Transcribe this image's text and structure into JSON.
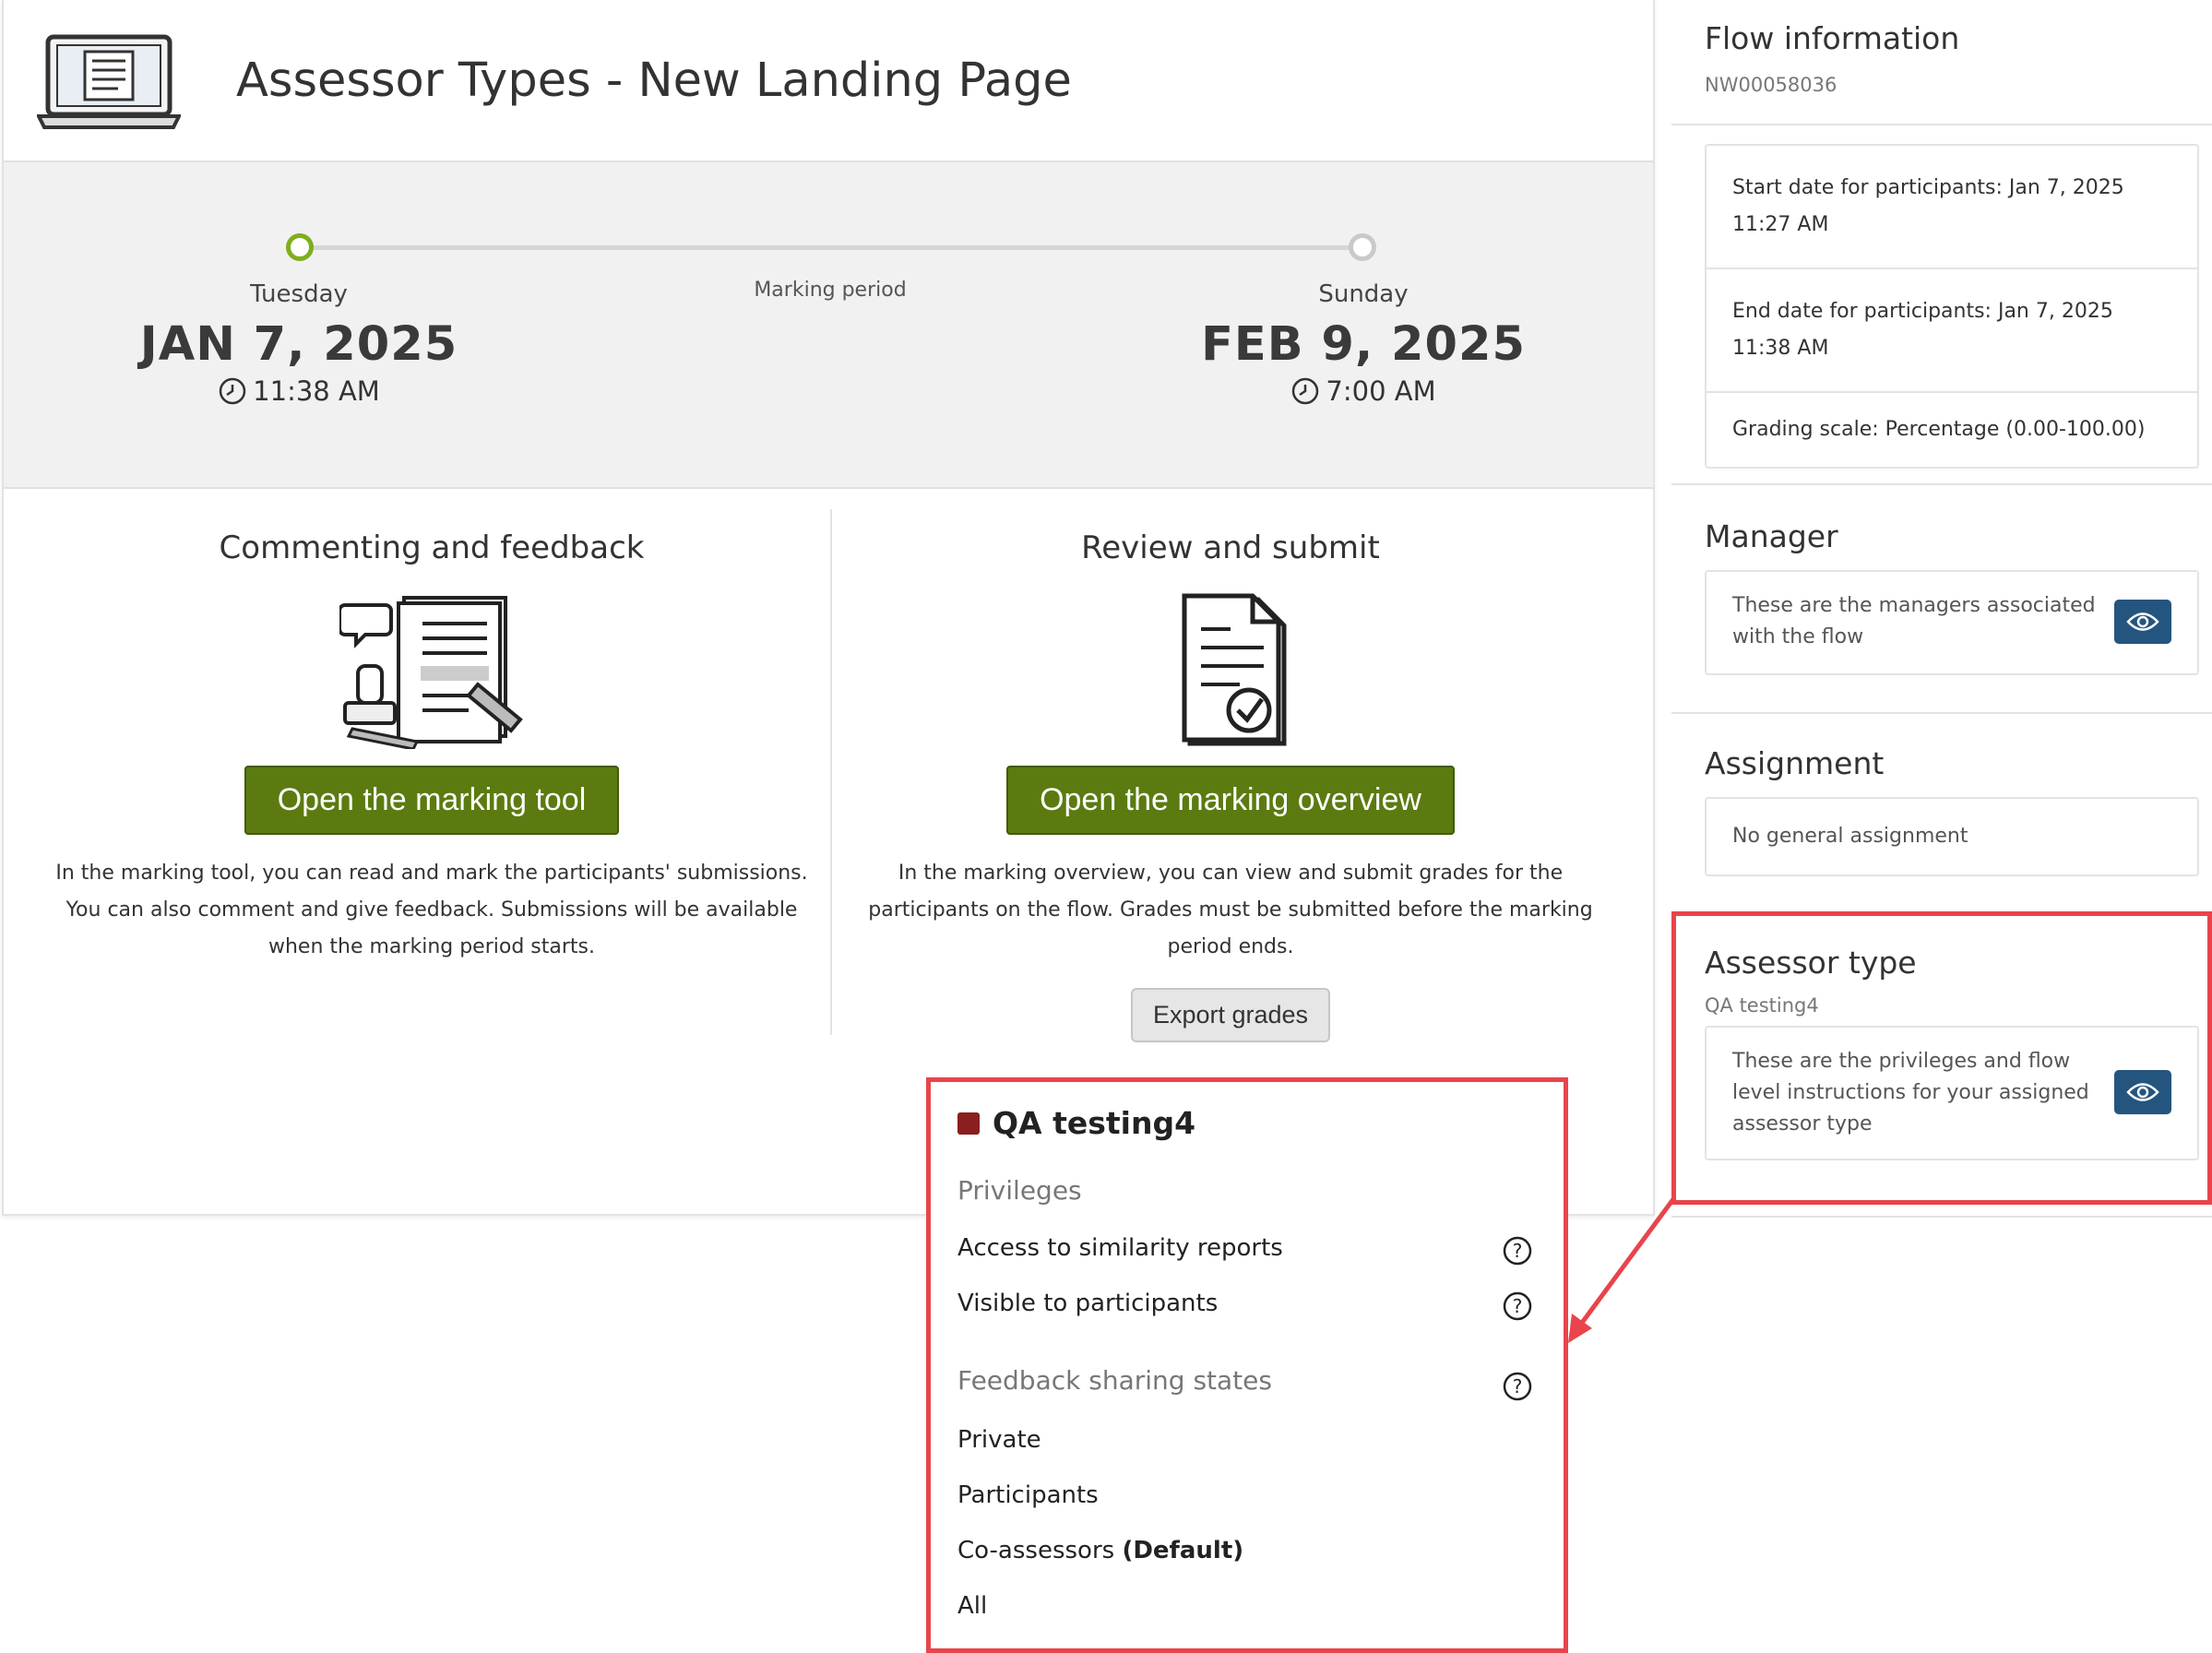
{
  "header": {
    "title": "Assessor Types - New Landing Page"
  },
  "period": {
    "label": "Marking period",
    "start": {
      "weekday": "Tuesday",
      "date": "JAN 7, 2025",
      "time": "11:38 AM"
    },
    "end": {
      "weekday": "Sunday",
      "date": "FEB 9, 2025",
      "time": "7:00 AM"
    }
  },
  "commenting": {
    "heading": "Commenting and feedback",
    "button": "Open the marking tool",
    "text": "In the marking tool, you can read and mark the participants' submissions. You can also comment and give feedback. Submissions will be available when the marking period starts."
  },
  "review": {
    "heading": "Review and submit",
    "button": "Open the marking overview",
    "text": "In the marking overview, you can view and submit grades for the participants on the flow. Grades must be submitted before the marking period ends.",
    "export_button": "Export grades"
  },
  "sidebar": {
    "flow_info": {
      "title": "Flow information",
      "id": "NW00058036",
      "rows": [
        "Start date for participants: Jan 7, 2025 11:27 AM",
        "End date for participants: Jan 7, 2025 11:38 AM",
        "Grading scale: Percentage (0.00-100.00)"
      ]
    },
    "manager": {
      "title": "Manager",
      "text": "These are the managers associated with the flow"
    },
    "assignment": {
      "title": "Assignment",
      "text": "No general assignment"
    },
    "assessor_type": {
      "title": "Assessor type",
      "name": "QA testing4",
      "text": "These are the privileges and flow level instructions for your assigned assessor type"
    }
  },
  "popup": {
    "title": "QA testing4",
    "swatch_color": "#8a1f1f",
    "privileges_heading": "Privileges",
    "privileges": [
      "Access to similarity reports",
      "Visible to participants"
    ],
    "sharing_heading": "Feedback sharing states",
    "sharing_states": [
      "Private",
      "Participants",
      "Co-assessors",
      "All"
    ],
    "default_label": "(Default)"
  },
  "colors": {
    "primary_button": "#5b7b10",
    "eye_button": "#24557e",
    "annotation": "#e9444b",
    "timeline_active": "#7fae1b"
  }
}
